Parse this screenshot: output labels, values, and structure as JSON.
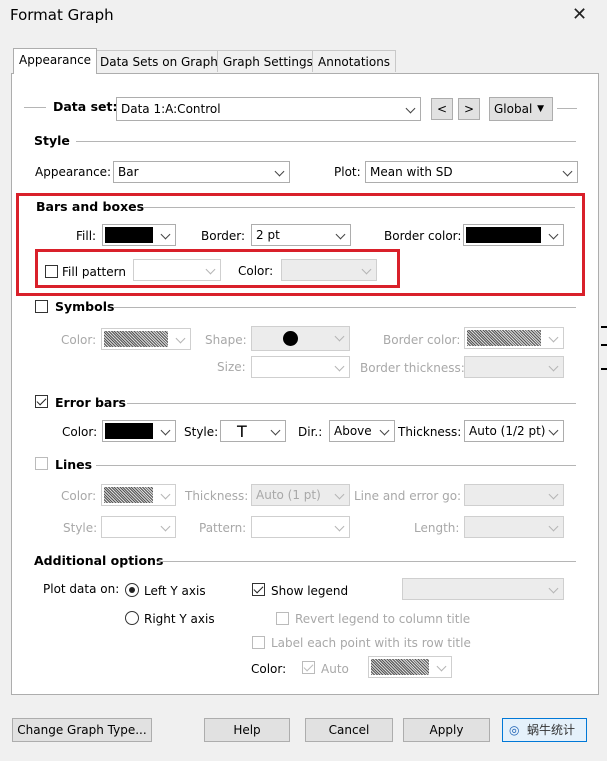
{
  "window": {
    "title": "Format Graph"
  },
  "tabs": [
    {
      "label": "Appearance"
    },
    {
      "label": "Data Sets on Graph"
    },
    {
      "label": "Graph Settings"
    },
    {
      "label": "Annotations"
    }
  ],
  "dataset": {
    "label": "Data set:",
    "value": "Data 1:A:Control",
    "prev": "<",
    "next": ">",
    "scope": "Global"
  },
  "style": {
    "header": "Style",
    "appearance_label": "Appearance:",
    "appearance_value": "Bar",
    "plot_label": "Plot:",
    "plot_value": "Mean with SD"
  },
  "bars": {
    "header": "Bars and boxes",
    "fill_label": "Fill:",
    "fill_color": "#000000",
    "border_label": "Border:",
    "border_value": "2 pt",
    "border_color_label": "Border color:",
    "border_color": "#000000",
    "fill_pattern_label": "Fill pattern",
    "color_label": "Color:"
  },
  "symbols": {
    "header": "Symbols",
    "color_label": "Color:",
    "shape_label": "Shape:",
    "border_color_label": "Border color:",
    "size_label": "Size:",
    "border_thickness_label": "Border thickness:"
  },
  "error_bars": {
    "header": "Error bars",
    "checked": true,
    "color_label": "Color:",
    "style_label": "Style:",
    "style_value": "T",
    "dir_label": "Dir.:",
    "dir_value": "Above",
    "thickness_label": "Thickness:",
    "thickness_value": "Auto (1/2 pt)"
  },
  "lines": {
    "header": "Lines",
    "color_label": "Color:",
    "thickness_label": "Thickness:",
    "thickness_value": "Auto (1 pt)",
    "line_error_label": "Line and error go:",
    "style_label": "Style:",
    "pattern_label": "Pattern:",
    "length_label": "Length:"
  },
  "additional": {
    "header": "Additional options",
    "plot_on_label": "Plot data on:",
    "left_axis": "Left Y axis",
    "right_axis": "Right  Y axis",
    "show_legend": "Show legend",
    "revert_legend": "Revert legend to column title",
    "label_each": "Label each point with its row title",
    "color_label": "Color:",
    "auto_label": "Auto"
  },
  "footer": {
    "change_type": "Change Graph Type...",
    "help": "Help",
    "cancel": "Cancel",
    "apply": "Apply",
    "watermark": "蜗牛统计"
  },
  "colors": {
    "highlight_red": "#d9202a",
    "accent_blue": "#0078d7"
  }
}
